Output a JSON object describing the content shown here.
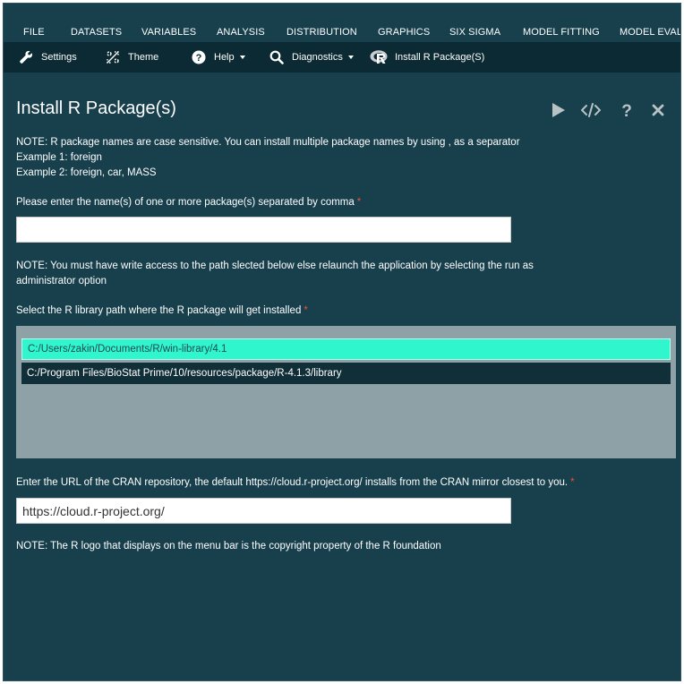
{
  "menubar": {
    "items": [
      "FILE",
      "DATASETS",
      "VARIABLES",
      "ANALYSIS",
      "DISTRIBUTION",
      "GRAPHICS",
      "SIX SIGMA",
      "MODEL FITTING",
      "MODEL EVALUA"
    ]
  },
  "toolbar": {
    "settings": "Settings",
    "theme": "Theme",
    "help": "Help",
    "diagnostics": "Diagnostics",
    "install": "Install R Package(S)"
  },
  "dialog": {
    "title": "Install R Package(s)",
    "note1_line1": "NOTE: R package names are case sensitive. You can install multiple package names by using , as a separator",
    "note1_line2": "Example 1: foreign",
    "note1_line3": "Example 2: foreign, car, MASS",
    "pkg_label": "Please enter the name(s) of one or more package(s) separated by comma",
    "pkg_value": "",
    "note2_line1": "NOTE: You must have write access to the path slected below else relaunch the application by selecting the run as",
    "note2_line2": "administrator option",
    "lib_label": "Select the R library path where the R package will get installed",
    "lib_options": [
      "C:/Users/zakin/Documents/R/win-library/4.1",
      "C:/Program Files/BioStat Prime/10/resources/package/R-4.1.3/library"
    ],
    "cran_label": "Enter the URL of the CRAN repository, the default https://cloud.r-project.org/ installs from the CRAN mirror closest to you.",
    "cran_value": "https://cloud.r-project.org/",
    "note3": "NOTE: The R logo that displays on the menu bar is the copyright property of the R foundation",
    "required_mark": "*"
  },
  "colors": {
    "background": "#173f4c",
    "toolbar": "#0c2a33",
    "selected": "#2ff6cc",
    "required": "#e8503a"
  }
}
